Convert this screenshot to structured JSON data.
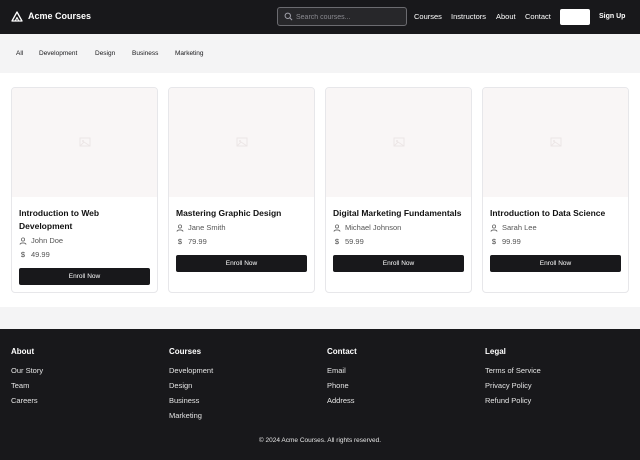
{
  "header": {
    "brand": "Acme Courses",
    "search": {
      "placeholder": "Search courses...",
      "value": ""
    },
    "nav": [
      "Courses",
      "Instructors",
      "About",
      "Contact"
    ],
    "signup_label": "Sign Up"
  },
  "categories": [
    "All",
    "Development",
    "Design",
    "Business",
    "Marketing"
  ],
  "courses": [
    {
      "title": "Introduction to Web Development",
      "instructor": "John Doe",
      "currency": "$",
      "price": "$49.99",
      "enroll_label": "Enroll Now"
    },
    {
      "title": "Mastering Graphic Design",
      "instructor": "Jane Smith",
      "currency": "$",
      "price": "$79.99",
      "enroll_label": "Enroll Now"
    },
    {
      "title": "Digital Marketing Fundamentals",
      "instructor": "Michael Johnson",
      "currency": "$",
      "price": "$59.99",
      "enroll_label": "Enroll Now"
    },
    {
      "title": "Introduction to Data Science",
      "instructor": "Sarah Lee",
      "currency": "$",
      "price": "$99.99",
      "enroll_label": "Enroll Now"
    }
  ],
  "footer": {
    "columns": [
      {
        "heading": "About",
        "links": [
          "Our Story",
          "Team",
          "Careers"
        ]
      },
      {
        "heading": "Courses",
        "links": [
          "Development",
          "Design",
          "Business",
          "Marketing"
        ]
      },
      {
        "heading": "Contact",
        "links": [
          "Email",
          "Phone",
          "Address"
        ]
      },
      {
        "heading": "Legal",
        "links": [
          "Terms of Service",
          "Privacy Policy",
          "Refund Policy"
        ]
      }
    ],
    "copyright": "© 2024 Acme Courses. All rights reserved."
  },
  "colors": {
    "header_bg": "#18181b",
    "catbar_bg": "#f4f4f5",
    "button_bg": "#18181b",
    "card_image_bg": "#f9f6f6",
    "footer_bg": "#18181b"
  },
  "icons": {
    "logo": "mountain-icon",
    "search": "search-icon",
    "instructor": "user-icon",
    "price": "dollar-icon",
    "image_placeholder": "image-placeholder-icon"
  }
}
